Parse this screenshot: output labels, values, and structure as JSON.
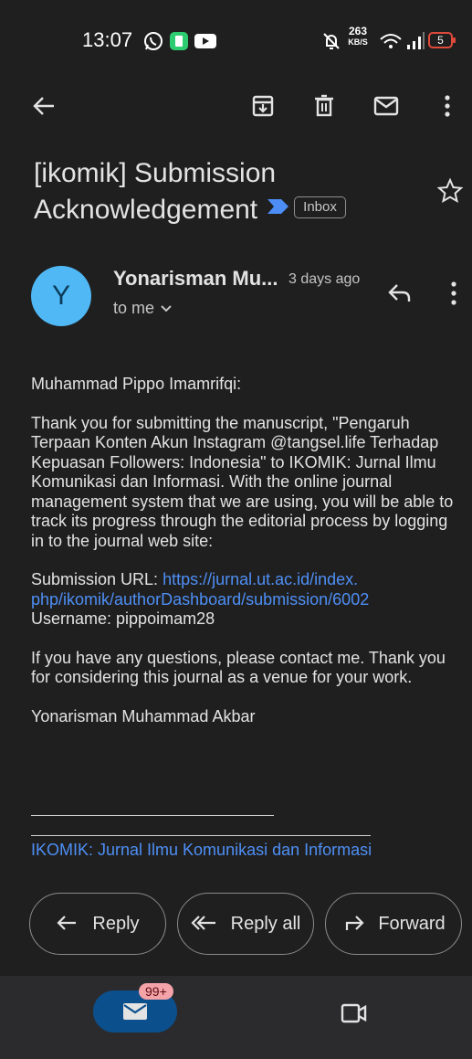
{
  "status_bar": {
    "time": "13:07",
    "net_speed_top": "263",
    "net_speed_bottom": "KB/S",
    "battery": "5"
  },
  "email": {
    "subject_line1": "[ikomik] Submission",
    "subject_line2": "Acknowledgement",
    "label": "Inbox",
    "sender_avatar": "Y",
    "sender": "Yonarisman Mu...",
    "time": "3 days ago",
    "recipient": "to me",
    "body": {
      "greeting": "Muhammad Pippo Imamrifqi:",
      "para1": "Thank you for submitting the manuscript, \"Pengaruh Terpaan Konten Akun Instagram @tangsel.life Terhadap Kepuasan Followers: Indonesia\" to IKOMIK: Jurnal Ilmu Komunikasi dan Informasi. With the online journal management system that we are using, you will be able to track its progress through the editorial process by logging in to the journal web site:",
      "url_label": "Submission URL: ",
      "url_line1": "https://jurnal.ut.ac.id/index.",
      "url_line2": "php/ikomik/authorDashboard/submission/6002",
      "username": "Username: pippoimam28",
      "para2": "If you have any questions, please contact me. Thank you for considering this journal as a venue for your work.",
      "signature": "Yonarisman Muhammad Akbar",
      "journal_link": "IKOMIK: Jurnal Ilmu Komunikasi dan Informasi"
    }
  },
  "actions": {
    "reply": "Reply",
    "reply_all": "Reply all",
    "forward": "Forward"
  },
  "bottom_nav": {
    "mail_badge": "99+"
  },
  "colors": {
    "background": "#1f1f1f",
    "avatar": "#4fb8f5",
    "link": "#4e8ff5",
    "nav_bar": "#2b2b2e",
    "mail_pill": "#0b4f8c",
    "badge": "#f4a3a8",
    "important_marker": "#4c8df6"
  }
}
